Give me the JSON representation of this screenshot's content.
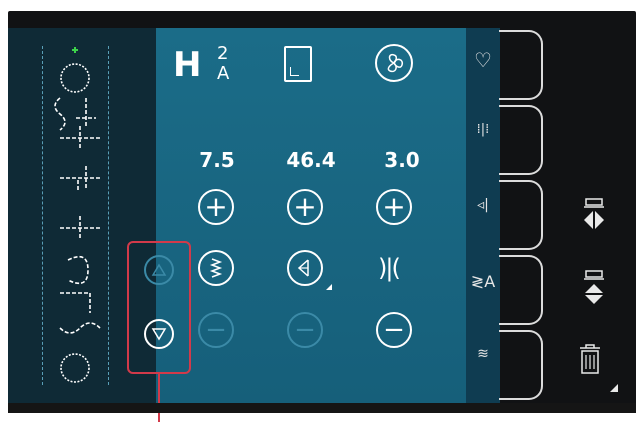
{
  "stitch_settings": {
    "width_value": "7.5",
    "length_value": "46.4",
    "density_value": "3.0"
  },
  "top_icons": {
    "presser_foot": {
      "name": "presser-foot-h-icon",
      "label": "H",
      "superscript": "2",
      "subscript": "A"
    },
    "stitch_plate": {
      "name": "stitch-plate-icon"
    },
    "stitch_mode": {
      "name": "fan-stitch-icon"
    }
  },
  "side_tabs": [
    {
      "name": "favorites-heart-icon"
    },
    {
      "name": "stitch-options-icon"
    },
    {
      "name": "tension-icon"
    },
    {
      "name": "font-icon"
    },
    {
      "name": "sequence-icon"
    }
  ],
  "right_buttons": [
    {
      "name": "mirror-side-to-side-icon"
    },
    {
      "name": "mirror-end-to-end-icon"
    },
    {
      "name": "delete-trash-icon"
    }
  ],
  "colors": {
    "panel": "#1b6c88",
    "highlight": "#d23a4a"
  }
}
